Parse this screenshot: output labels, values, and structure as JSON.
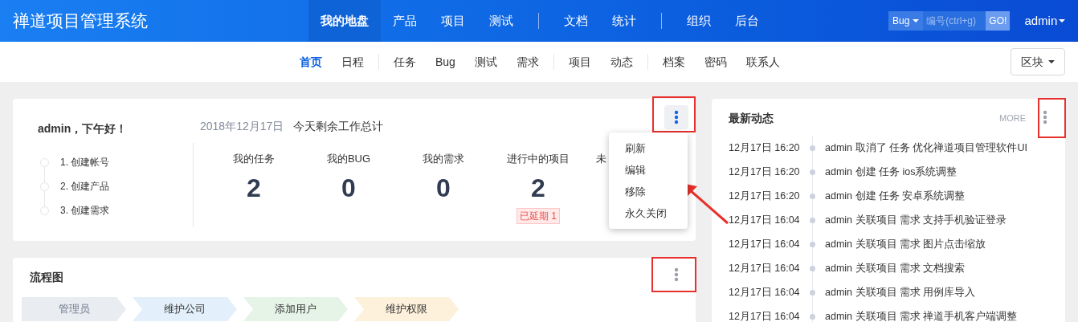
{
  "header": {
    "brand": "禅道项目管理系统",
    "nav_groups": [
      [
        {
          "label": "我的地盘",
          "selected": true
        },
        {
          "label": "产品",
          "selected": false
        },
        {
          "label": "项目",
          "selected": false
        },
        {
          "label": "测试",
          "selected": false
        }
      ],
      [
        {
          "label": "文档",
          "selected": false
        },
        {
          "label": "统计",
          "selected": false
        }
      ],
      [
        {
          "label": "组织",
          "selected": false
        },
        {
          "label": "后台",
          "selected": false
        }
      ]
    ],
    "search": {
      "type": "Bug",
      "placeholder": "编号(ctrl+g)",
      "button": "GO!"
    },
    "user": "admin"
  },
  "subnav": {
    "groups": [
      [
        {
          "label": "首页",
          "selected": true
        },
        {
          "label": "日程",
          "selected": false
        }
      ],
      [
        {
          "label": "任务",
          "selected": false
        },
        {
          "label": "Bug",
          "selected": false
        },
        {
          "label": "测试",
          "selected": false
        },
        {
          "label": "需求",
          "selected": false
        }
      ],
      [
        {
          "label": "项目",
          "selected": false
        },
        {
          "label": "动态",
          "selected": false
        }
      ],
      [
        {
          "label": "档案",
          "selected": false
        },
        {
          "label": "密码",
          "selected": false
        },
        {
          "label": "联系人",
          "selected": false
        }
      ]
    ],
    "block_button": "区块"
  },
  "welcome": {
    "greeting": "admin，下午好！",
    "steps": [
      "1. 创建帐号",
      "2. 创建产品",
      "3. 创建需求"
    ],
    "date": "2018年12月17日",
    "summary_title": "今天剩余工作总计",
    "stats": [
      {
        "label": "我的任务",
        "value": "2"
      },
      {
        "label": "我的BUG",
        "value": "0"
      },
      {
        "label": "我的需求",
        "value": "0"
      },
      {
        "label": "进行中的项目",
        "value": "2",
        "badge": "已延期 1"
      },
      {
        "label": "未"
      }
    ],
    "menu_open": true,
    "menu": [
      "刷新",
      "编辑",
      "移除",
      "永久关闭"
    ]
  },
  "flow": {
    "title": "流程图",
    "menu_open": false,
    "steps": [
      {
        "label": "管理员",
        "color": "#e9ecf0"
      },
      {
        "label": "维护公司",
        "color": "#e3f0fb"
      },
      {
        "label": "添加用户",
        "color": "#e6f4e8"
      },
      {
        "label": "维护权限",
        "color": "#fdf1dc"
      }
    ]
  },
  "activity": {
    "title": "最新动态",
    "more": "MORE",
    "menu_open": false,
    "items": [
      {
        "time": "12月17日 16:20",
        "text": "admin 取消了 任务 优化禅道项目管理软件UI"
      },
      {
        "time": "12月17日 16:20",
        "text": "admin 创建 任务 ios系统调整"
      },
      {
        "time": "12月17日 16:20",
        "text": "admin 创建 任务 安卓系统调整"
      },
      {
        "time": "12月17日 16:04",
        "text": "admin 关联项目 需求 支持手机验证登录"
      },
      {
        "time": "12月17日 16:04",
        "text": "admin 关联项目 需求 图片点击缩放"
      },
      {
        "time": "12月17日 16:04",
        "text": "admin 关联项目 需求 文档搜索"
      },
      {
        "time": "12月17日 16:04",
        "text": "admin 关联项目 需求 用例库导入"
      },
      {
        "time": "12月17日 16:04",
        "text": "admin 关联项目 需求 禅道手机客户端调整"
      }
    ]
  }
}
